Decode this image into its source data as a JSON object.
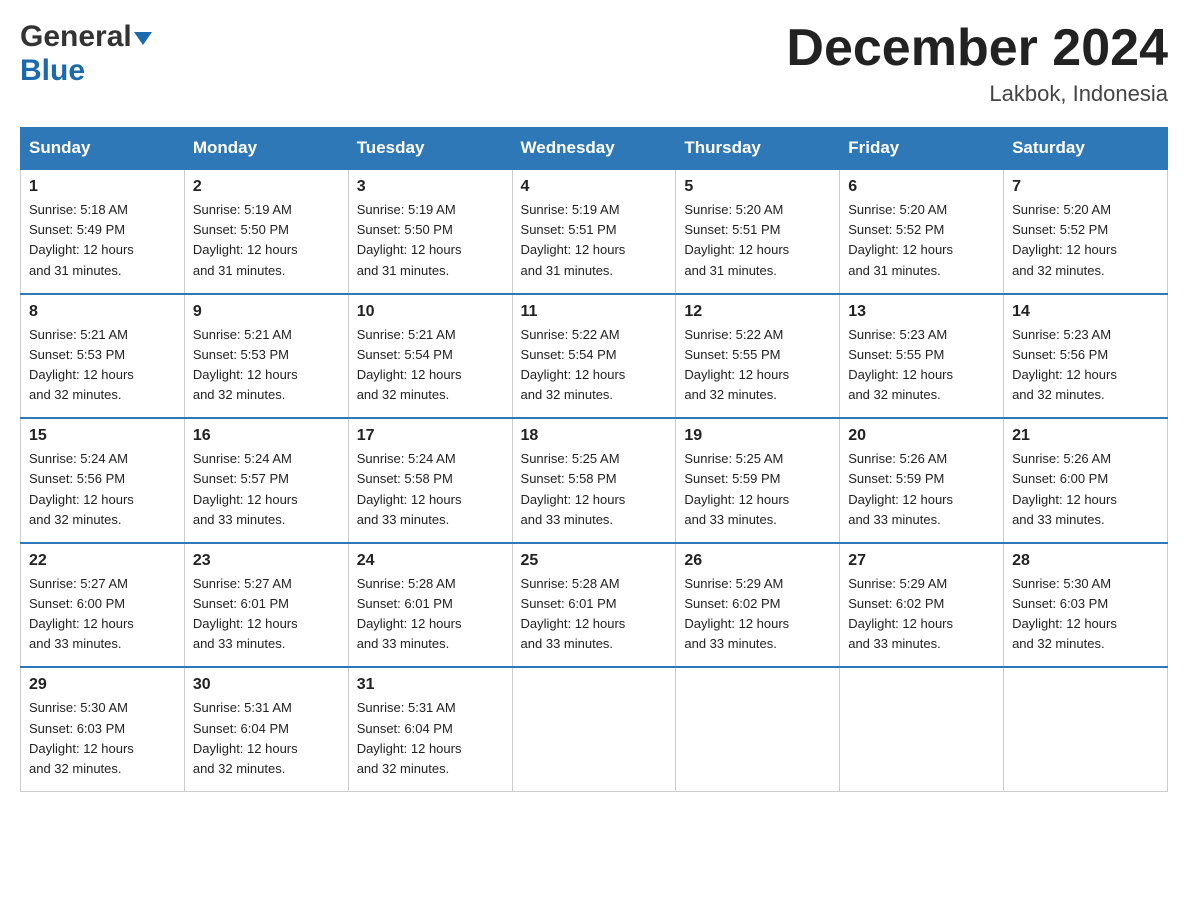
{
  "header": {
    "logo_general": "General",
    "logo_blue": "Blue",
    "month_title": "December 2024",
    "location": "Lakbok, Indonesia"
  },
  "columns": [
    "Sunday",
    "Monday",
    "Tuesday",
    "Wednesday",
    "Thursday",
    "Friday",
    "Saturday"
  ],
  "weeks": [
    [
      {
        "day": "1",
        "sunrise": "5:18 AM",
        "sunset": "5:49 PM",
        "daylight": "12 hours and 31 minutes."
      },
      {
        "day": "2",
        "sunrise": "5:19 AM",
        "sunset": "5:50 PM",
        "daylight": "12 hours and 31 minutes."
      },
      {
        "day": "3",
        "sunrise": "5:19 AM",
        "sunset": "5:50 PM",
        "daylight": "12 hours and 31 minutes."
      },
      {
        "day": "4",
        "sunrise": "5:19 AM",
        "sunset": "5:51 PM",
        "daylight": "12 hours and 31 minutes."
      },
      {
        "day": "5",
        "sunrise": "5:20 AM",
        "sunset": "5:51 PM",
        "daylight": "12 hours and 31 minutes."
      },
      {
        "day": "6",
        "sunrise": "5:20 AM",
        "sunset": "5:52 PM",
        "daylight": "12 hours and 31 minutes."
      },
      {
        "day": "7",
        "sunrise": "5:20 AM",
        "sunset": "5:52 PM",
        "daylight": "12 hours and 32 minutes."
      }
    ],
    [
      {
        "day": "8",
        "sunrise": "5:21 AM",
        "sunset": "5:53 PM",
        "daylight": "12 hours and 32 minutes."
      },
      {
        "day": "9",
        "sunrise": "5:21 AM",
        "sunset": "5:53 PM",
        "daylight": "12 hours and 32 minutes."
      },
      {
        "day": "10",
        "sunrise": "5:21 AM",
        "sunset": "5:54 PM",
        "daylight": "12 hours and 32 minutes."
      },
      {
        "day": "11",
        "sunrise": "5:22 AM",
        "sunset": "5:54 PM",
        "daylight": "12 hours and 32 minutes."
      },
      {
        "day": "12",
        "sunrise": "5:22 AM",
        "sunset": "5:55 PM",
        "daylight": "12 hours and 32 minutes."
      },
      {
        "day": "13",
        "sunrise": "5:23 AM",
        "sunset": "5:55 PM",
        "daylight": "12 hours and 32 minutes."
      },
      {
        "day": "14",
        "sunrise": "5:23 AM",
        "sunset": "5:56 PM",
        "daylight": "12 hours and 32 minutes."
      }
    ],
    [
      {
        "day": "15",
        "sunrise": "5:24 AM",
        "sunset": "5:56 PM",
        "daylight": "12 hours and 32 minutes."
      },
      {
        "day": "16",
        "sunrise": "5:24 AM",
        "sunset": "5:57 PM",
        "daylight": "12 hours and 33 minutes."
      },
      {
        "day": "17",
        "sunrise": "5:24 AM",
        "sunset": "5:58 PM",
        "daylight": "12 hours and 33 minutes."
      },
      {
        "day": "18",
        "sunrise": "5:25 AM",
        "sunset": "5:58 PM",
        "daylight": "12 hours and 33 minutes."
      },
      {
        "day": "19",
        "sunrise": "5:25 AM",
        "sunset": "5:59 PM",
        "daylight": "12 hours and 33 minutes."
      },
      {
        "day": "20",
        "sunrise": "5:26 AM",
        "sunset": "5:59 PM",
        "daylight": "12 hours and 33 minutes."
      },
      {
        "day": "21",
        "sunrise": "5:26 AM",
        "sunset": "6:00 PM",
        "daylight": "12 hours and 33 minutes."
      }
    ],
    [
      {
        "day": "22",
        "sunrise": "5:27 AM",
        "sunset": "6:00 PM",
        "daylight": "12 hours and 33 minutes."
      },
      {
        "day": "23",
        "sunrise": "5:27 AM",
        "sunset": "6:01 PM",
        "daylight": "12 hours and 33 minutes."
      },
      {
        "day": "24",
        "sunrise": "5:28 AM",
        "sunset": "6:01 PM",
        "daylight": "12 hours and 33 minutes."
      },
      {
        "day": "25",
        "sunrise": "5:28 AM",
        "sunset": "6:01 PM",
        "daylight": "12 hours and 33 minutes."
      },
      {
        "day": "26",
        "sunrise": "5:29 AM",
        "sunset": "6:02 PM",
        "daylight": "12 hours and 33 minutes."
      },
      {
        "day": "27",
        "sunrise": "5:29 AM",
        "sunset": "6:02 PM",
        "daylight": "12 hours and 33 minutes."
      },
      {
        "day": "28",
        "sunrise": "5:30 AM",
        "sunset": "6:03 PM",
        "daylight": "12 hours and 32 minutes."
      }
    ],
    [
      {
        "day": "29",
        "sunrise": "5:30 AM",
        "sunset": "6:03 PM",
        "daylight": "12 hours and 32 minutes."
      },
      {
        "day": "30",
        "sunrise": "5:31 AM",
        "sunset": "6:04 PM",
        "daylight": "12 hours and 32 minutes."
      },
      {
        "day": "31",
        "sunrise": "5:31 AM",
        "sunset": "6:04 PM",
        "daylight": "12 hours and 32 minutes."
      },
      null,
      null,
      null,
      null
    ]
  ],
  "labels": {
    "sunrise": "Sunrise:",
    "sunset": "Sunset:",
    "daylight": "Daylight:"
  }
}
